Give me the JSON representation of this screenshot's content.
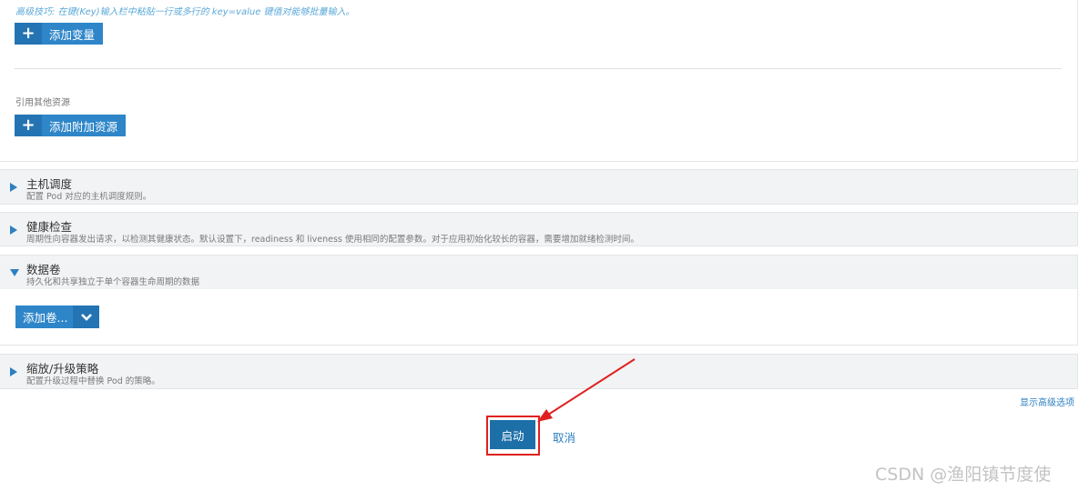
{
  "env": {
    "tip": "高级技巧: 在键(Key)输入栏中粘贴一行或多行的 key=value 键值对能够批量输入。",
    "add_variable_label": "添加变量",
    "ref_resources_label": "引用其他资源",
    "add_resource_label": "添加附加资源"
  },
  "panels": {
    "scheduling": {
      "title": "主机调度",
      "desc": "配置 Pod 对应的主机调度规则。"
    },
    "health": {
      "title": "健康检查",
      "desc": "周期性向容器发出请求，以检测其健康状态。默认设置下，readiness 和 liveness 使用相同的配置参数。对于应用初始化较长的容器，需要增加就绪检测时间。"
    },
    "volumes": {
      "title": "数据卷",
      "desc": "持久化和共享独立于单个容器生命周期的数据",
      "add_volume_label": "添加卷..."
    },
    "upgrade": {
      "title": "缩放/升级策略",
      "desc": "配置升级过程中替换 Pod 的策略。"
    }
  },
  "footer": {
    "advanced_link": "显示高级选项",
    "launch_label": "启动",
    "cancel_label": "取消"
  },
  "watermark": "CSDN @渔阳镇节度使",
  "colors": {
    "primary": "#2e86c9",
    "primary_dark": "#2474b3",
    "launch": "#1d6fa8",
    "highlight": "#e02020"
  },
  "icons": {
    "add": "plus-icon",
    "expand": "caret-right-icon",
    "collapse": "caret-down-icon",
    "dropdown": "chevron-down-icon"
  }
}
